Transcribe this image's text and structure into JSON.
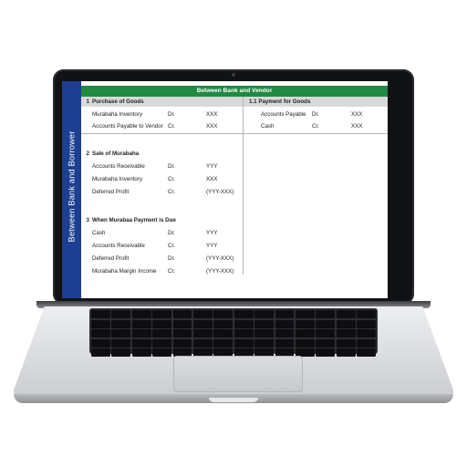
{
  "sheet": {
    "banner": "Between Bank and Vendor",
    "side_label": "Between Bank and Borrower",
    "left_sections": [
      {
        "num": "1",
        "title": "Purchase of Goods",
        "rows": [
          {
            "account": "Murabaha Inventory",
            "drcr": "Dr.",
            "amount": "XXX"
          },
          {
            "account": "Accounts Payable to Vendor",
            "drcr": "Cr.",
            "amount": "XXX"
          }
        ]
      },
      {
        "num": "2",
        "title": "Sale of Murabaha",
        "rows": [
          {
            "account": "Accounts Receivable",
            "drcr": "Dr.",
            "amount": "YYY"
          },
          {
            "account": "Murabaha Inventory",
            "drcr": "Cr.",
            "amount": "XXX"
          },
          {
            "account": "Deferred Profit",
            "drcr": "Cr.",
            "amount": "(YYY-XXX)"
          }
        ]
      },
      {
        "num": "3",
        "title": "When Murabaa Payment is Due",
        "rows": [
          {
            "account": "Cash",
            "drcr": "Dr.",
            "amount": "YYY"
          },
          {
            "account": "Accounts Receivable",
            "drcr": "Cr.",
            "amount": "YYY"
          },
          {
            "account": "Deferred Profit",
            "drcr": "Dr.",
            "amount": "(YYY-XXX)"
          },
          {
            "account": "Murabaha Margin Income",
            "drcr": "Cr.",
            "amount": "(YYY-XXX)"
          }
        ]
      }
    ],
    "right_section": {
      "title": "1.1 Payment for Goods",
      "rows": [
        {
          "account": "Accounts Payable",
          "drcr": "Dr.",
          "amount": "XXX"
        },
        {
          "account": "Cash",
          "drcr": "Cr.",
          "amount": "XXX"
        }
      ]
    }
  }
}
